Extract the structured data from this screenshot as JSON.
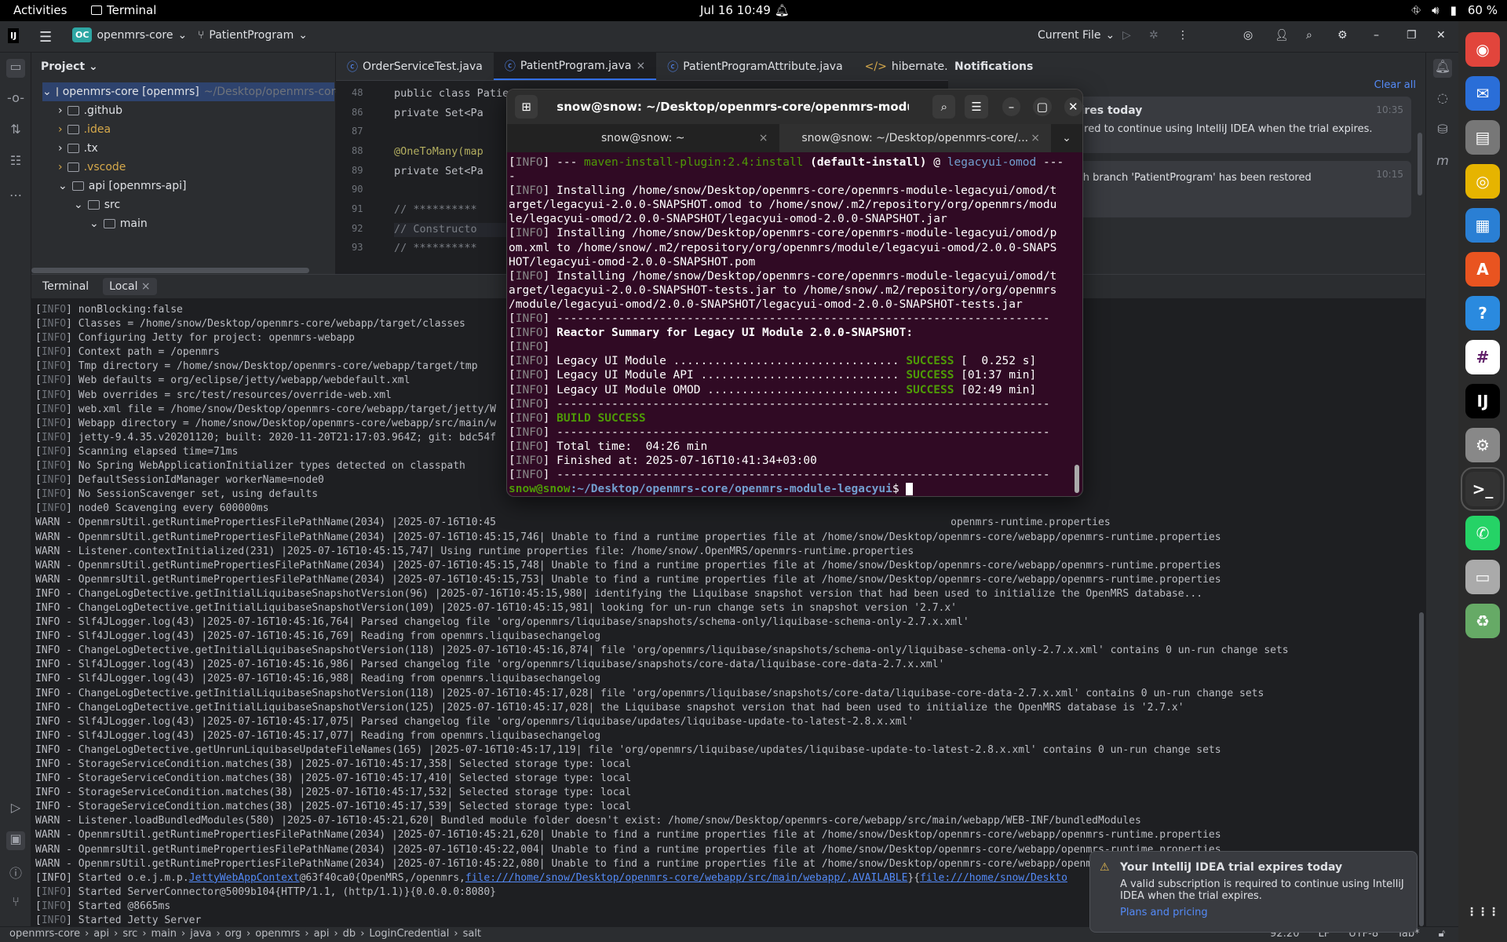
{
  "system": {
    "activities": "Activities",
    "app": "Terminal",
    "clock": "Jul 16  10:49",
    "battery": "60 %"
  },
  "titlebar": {
    "logo": "IJ",
    "project_badge": "OC",
    "project": "openmrs-core",
    "branch": "PatientProgram",
    "run_config": "Current File"
  },
  "project_panel": {
    "title": "Project",
    "items": [
      {
        "label": "openmrs-core [openmrs]",
        "suffix": "~/Desktop/openmrs-core"
      },
      {
        "label": ".github"
      },
      {
        "label": ".idea"
      },
      {
        "label": ".tx"
      },
      {
        "label": ".vscode"
      },
      {
        "label": "api [openmrs-api]"
      },
      {
        "label": "src"
      },
      {
        "label": "main"
      }
    ]
  },
  "editor": {
    "tabs": [
      "OrderServiceTest.java",
      "PatientProgram.java",
      "PatientProgramAttribute.java",
      "hibernate.c"
    ],
    "lines": [
      {
        "num": "48",
        "text": "public class Patie"
      },
      {
        "num": "86",
        "text": "    private Set<Pa"
      },
      {
        "num": "87",
        "text": ""
      },
      {
        "num": "88",
        "text": "    @OneToMany(map"
      },
      {
        "num": "89",
        "text": "    private Set<Pa"
      },
      {
        "num": "90",
        "text": ""
      },
      {
        "num": "91",
        "text": "    // **********"
      },
      {
        "num": "92",
        "text": "    // Constructo"
      },
      {
        "num": "93",
        "text": "    // **********"
      }
    ]
  },
  "notifications": {
    "title": "Notifications",
    "clear_all": "Clear all",
    "items": [
      {
        "title": "expires today",
        "body": "required to continue using IntelliJ IDEA when the trial expires.",
        "time": "10:35"
      },
      {
        "title": "",
        "body": "d with branch 'PatientProgram' has been restored",
        "time": "10:15"
      }
    ]
  },
  "terminal_panel": {
    "title": "Terminal",
    "tab": "Local",
    "lines": [
      "[INFO] nonBlocking:false",
      "[INFO] Classes = /home/snow/Desktop/openmrs-core/webapp/target/classes",
      "[INFO] Configuring Jetty for project: openmrs-webapp",
      "[INFO] Context path = /openmrs",
      "[INFO] Tmp directory = /home/snow/Desktop/openmrs-core/webapp/target/tmp",
      "[INFO] Web defaults = org/eclipse/jetty/webapp/webdefault.xml",
      "[INFO] Web overrides = src/test/resources/override-web.xml",
      "[INFO] web.xml file = /home/snow/Desktop/openmrs-core/webapp/target/jetty/W",
      "[INFO] Webapp directory = /home/snow/Desktop/openmrs-core/webapp/src/main/w",
      "[INFO] jetty-9.4.35.v20201120; built: 2020-11-20T21:17:03.964Z; git: bdc54f",
      "[INFO] Scanning elapsed time=71ms",
      "[INFO] No Spring WebApplicationInitializer types detected on classpath",
      "[INFO] DefaultSessionIdManager workerName=node0",
      "[INFO] No SessionScavenger set, using defaults",
      "[INFO] node0 Scavenging every 600000ms",
      "WARN - OpenmrsUtil.getRuntimePropertiesFilePathName(2034) |2025-07-16T10:45                                                                          openmrs-runtime.properties",
      "WARN - OpenmrsUtil.getRuntimePropertiesFilePathName(2034) |2025-07-16T10:45:15,746| Unable to find a runtime properties file at /home/snow/Desktop/openmrs-core/webapp/openmrs-runtime.properties",
      "WARN - Listener.contextInitialized(231) |2025-07-16T10:45:15,747| Using runtime properties file: /home/snow/.OpenMRS/openmrs-runtime.properties",
      "WARN - OpenmrsUtil.getRuntimePropertiesFilePathName(2034) |2025-07-16T10:45:15,748| Unable to find a runtime properties file at /home/snow/Desktop/openmrs-core/webapp/openmrs-runtime.properties",
      "WARN - OpenmrsUtil.getRuntimePropertiesFilePathName(2034) |2025-07-16T10:45:15,753| Unable to find a runtime properties file at /home/snow/Desktop/openmrs-core/webapp/openmrs-runtime.properties",
      "INFO - ChangeLogDetective.getInitialLiquibaseSnapshotVersion(96) |2025-07-16T10:45:15,980| identifying the Liquibase snapshot version that had been used to initialize the OpenMRS database...",
      "INFO - ChangeLogDetective.getInitialLiquibaseSnapshotVersion(109) |2025-07-16T10:45:15,981| looking for un-run change sets in snapshot version '2.7.x'",
      "INFO - Slf4JLogger.log(43) |2025-07-16T10:45:16,764| Parsed changelog file 'org/openmrs/liquibase/snapshots/schema-only/liquibase-schema-only-2.7.x.xml'",
      "INFO - Slf4JLogger.log(43) |2025-07-16T10:45:16,769| Reading from openmrs.liquibasechangelog",
      "INFO - ChangeLogDetective.getInitialLiquibaseSnapshotVersion(118) |2025-07-16T10:45:16,874| file 'org/openmrs/liquibase/snapshots/schema-only/liquibase-schema-only-2.7.x.xml' contains 0 un-run change sets",
      "INFO - Slf4JLogger.log(43) |2025-07-16T10:45:16,986| Parsed changelog file 'org/openmrs/liquibase/snapshots/core-data/liquibase-core-data-2.7.x.xml'",
      "INFO - Slf4JLogger.log(43) |2025-07-16T10:45:16,988| Reading from openmrs.liquibasechangelog",
      "INFO - ChangeLogDetective.getInitialLiquibaseSnapshotVersion(118) |2025-07-16T10:45:17,028| file 'org/openmrs/liquibase/snapshots/core-data/liquibase-core-data-2.7.x.xml' contains 0 un-run change sets",
      "INFO - ChangeLogDetective.getInitialLiquibaseSnapshotVersion(125) |2025-07-16T10:45:17,028| the Liquibase snapshot version that had been used to initialize the OpenMRS database is '2.7.x'",
      "INFO - Slf4JLogger.log(43) |2025-07-16T10:45:17,075| Parsed changelog file 'org/openmrs/liquibase/updates/liquibase-update-to-latest-2.8.x.xml'",
      "INFO - Slf4JLogger.log(43) |2025-07-16T10:45:17,077| Reading from openmrs.liquibasechangelog",
      "INFO - ChangeLogDetective.getUnrunLiquibaseUpdateFileNames(165) |2025-07-16T10:45:17,119| file 'org/openmrs/liquibase/updates/liquibase-update-to-latest-2.8.x.xml' contains 0 un-run change sets",
      "INFO - StorageServiceCondition.matches(38) |2025-07-16T10:45:17,358| Selected storage type: local",
      "INFO - StorageServiceCondition.matches(38) |2025-07-16T10:45:17,410| Selected storage type: local",
      "INFO - StorageServiceCondition.matches(38) |2025-07-16T10:45:17,532| Selected storage type: local",
      "INFO - StorageServiceCondition.matches(38) |2025-07-16T10:45:17,539| Selected storage type: local",
      "WARN - Listener.loadBundledModules(580) |2025-07-16T10:45:21,620| Bundled module folder doesn't exist: /home/snow/Desktop/openmrs-core/webapp/src/main/webapp/WEB-INF/bundledModules",
      "WARN - OpenmrsUtil.getRuntimePropertiesFilePathName(2034) |2025-07-16T10:45:21,620| Unable to find a runtime properties file at /home/snow/Desktop/openmrs-core/webapp/openmrs-runtime.properties",
      "WARN - OpenmrsUtil.getRuntimePropertiesFilePathName(2034) |2025-07-16T10:45:22,004| Unable to find a runtime properties file at /home/snow/Desktop/openmrs-core/webapp/openmrs-runtime.properties",
      "WARN - OpenmrsUtil.getRuntimePropertiesFilePathName(2034) |2025-07-16T10:45:22,080| Unable to find a runtime properties file at /home/snow/Desktop/openmrs-core/webapp/openmrs-runtime.properties"
    ],
    "started_context": {
      "prefix": "[INFO] Started o.e.j.m.p.",
      "link1": "JettyWebAppContext",
      "mid": "@63f40ca0{OpenMRS,/openmrs,",
      "link2": "file:///home/snow/Desktop/openmrs-core/webapp/src/main/webapp/,AVAILABLE",
      "mid2": "}{",
      "link3": "file:///home/snow/Deskto"
    },
    "tail": [
      "[INFO] Started ServerConnector@5009b104{HTTP/1.1, (http/1.1)}{0.0.0.0:8080}",
      "[INFO] Started @8665ms",
      "[INFO] Started Jetty Server"
    ]
  },
  "gnome_terminal": {
    "title": "snow@snow: ~/Desktop/openmrs-core/openmrs-module-leg...",
    "tabs": [
      "snow@snow: ~",
      "snow@snow: ~/Desktop/openmrs-core/..."
    ],
    "plugin_line": {
      "pre": "[INFO] --- ",
      "plugin": "maven-install-plugin:2.4:install",
      "goal": " (default-install)",
      "at": " @ ",
      "module": "legacyui-omod",
      "post": " ---"
    },
    "install_lines": [
      "[INFO] Installing /home/snow/Desktop/openmrs-core/openmrs-module-legacyui/omod/t",
      "arget/legacyui-2.0.0-SNAPSHOT.omod to /home/snow/.m2/repository/org/openmrs/modu",
      "le/legacyui-omod/2.0.0-SNAPSHOT/legacyui-omod-2.0.0-SNAPSHOT.jar",
      "[INFO] Installing /home/snow/Desktop/openmrs-core/openmrs-module-legacyui/omod/p",
      "om.xml to /home/snow/.m2/repository/org/openmrs/module/legacyui-omod/2.0.0-SNAPS",
      "HOT/legacyui-omod-2.0.0-SNAPSHOT.pom",
      "[INFO] Installing /home/snow/Desktop/openmrs-core/openmrs-module-legacyui/omod/t",
      "arget/legacyui-2.0.0-SNAPSHOT-tests.jar to /home/snow/.m2/repository/org/openmrs",
      "/module/legacyui-omod/2.0.0-SNAPSHOT/legacyui-omod-2.0.0-SNAPSHOT-tests.jar"
    ],
    "separator": "------------------------------------------------------------------------",
    "summary_title": "Reactor Summary for Legacy UI Module 2.0.0-SNAPSHOT:",
    "modules": [
      {
        "name": "Legacy UI Module ................................. ",
        "status": "SUCCESS",
        "time": " [  0.252 s]"
      },
      {
        "name": "Legacy UI Module API ............................. ",
        "status": "SUCCESS",
        "time": " [01:37 min]"
      },
      {
        "name": "Legacy UI Module OMOD ............................ ",
        "status": "SUCCESS",
        "time": " [02:49 min]"
      }
    ],
    "build": "BUILD SUCCESS",
    "total_time": "Total time:  04:26 min",
    "finished": "Finished at: 2025-07-16T10:41:34+03:00",
    "prompt_user": "snow@snow",
    "prompt_path": ":~/Desktop/openmrs-core/openmrs-module-legacyui",
    "prompt_sign": "$ "
  },
  "popup": {
    "title": "Your IntelliJ IDEA trial expires today",
    "body": "A valid subscription is required to continue using IntelliJ IDEA when the trial expires.",
    "link": "Plans and pricing"
  },
  "statusbar": {
    "crumbs": [
      "openmrs-core",
      "api",
      "src",
      "main",
      "java",
      "org",
      "openmrs",
      "api",
      "db",
      "LoginCredential",
      "salt"
    ],
    "position": "92:20",
    "line_sep": "LF",
    "encoding": "UTF-8",
    "indent": "Tab*"
  },
  "dock": {
    "apps": [
      "chrome-icon",
      "thunderbird-icon",
      "files-icon",
      "rhythmbox-icon",
      "writer-icon",
      "appcenter-icon",
      "help-icon",
      "slack-icon",
      "intellij-icon",
      "settings-icon",
      "terminal-icon",
      "whatsapp-icon",
      "disk-icon",
      "trash-icon",
      "apps-grid-icon"
    ]
  },
  "colors": {
    "accent": "#3574f0",
    "terminal_bg": "#300a24",
    "success": "#4e9a06"
  }
}
